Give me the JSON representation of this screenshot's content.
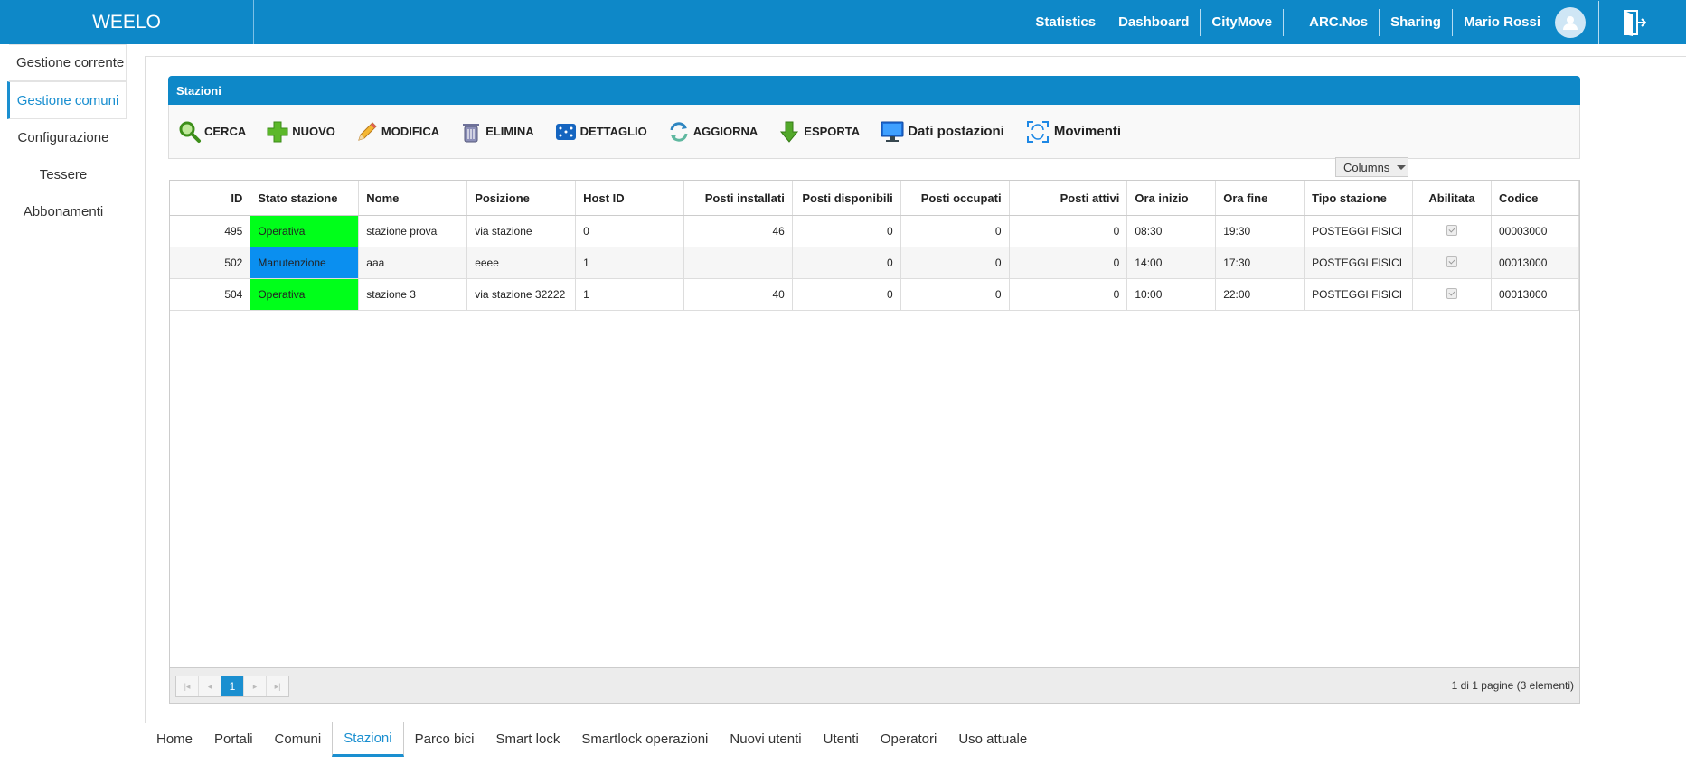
{
  "app": {
    "brand": "WEELO"
  },
  "topnav": {
    "items": [
      "Statistics",
      "Dashboard",
      "CityMove",
      "ARC.Nos",
      "Sharing"
    ],
    "user": "Mario Rossi"
  },
  "sidebar": {
    "items": [
      "Gestione corrente",
      "Gestione comuni",
      "Configurazione",
      "Tessere",
      "Abbonamenti"
    ]
  },
  "panel": {
    "title": "Stazioni"
  },
  "toolbar": {
    "cerca": "CERCA",
    "nuovo": "NUOVO",
    "modifica": "MODIFICA",
    "elimina": "ELIMINA",
    "dettaglio": "DETTAGLIO",
    "aggiorna": "AGGIORNA",
    "esporta": "ESPORTA",
    "dati_postazioni": "Dati postazioni",
    "movimenti": "Movimenti"
  },
  "columns_button": "Columns",
  "table": {
    "headers": [
      "ID",
      "Stato stazione",
      "Nome",
      "Posizione",
      "Host ID",
      "Posti installati",
      "Posti disponibili",
      "Posti occupati",
      "Posti attivi",
      "Ora inizio",
      "Ora fine",
      "Tipo stazione",
      "Abilitata",
      "Codice"
    ],
    "rows": [
      [
        "495",
        "Operativa",
        "stazione prova",
        "via stazione",
        "0",
        "46",
        "0",
        "0",
        "0",
        "08:30",
        "19:30",
        "POSTEGGI FISICI",
        "",
        "00003000"
      ],
      [
        "502",
        "Manutenzione",
        "aaa",
        "eeee",
        "1",
        "",
        "0",
        "0",
        "0",
        "14:00",
        "17:30",
        "POSTEGGI FISICI",
        "",
        "00013000"
      ],
      [
        "504",
        "Operativa",
        "stazione 3",
        "via stazione 32222",
        "1",
        "40",
        "0",
        "0",
        "0",
        "10:00",
        "22:00",
        "POSTEGGI FISICI",
        "",
        "00013000"
      ]
    ],
    "status_colors": {
      "Operativa": "#00ff1a",
      "Manutenzione": "#0a8ff0"
    }
  },
  "pager": {
    "current_page": "1",
    "info": "1 di 1 pagine (3 elementi)"
  },
  "tabs": [
    "Home",
    "Portali",
    "Comuni",
    "Stazioni",
    "Parco bici",
    "Smart lock",
    "Smartlock operazioni",
    "Nuovi utenti",
    "Utenti",
    "Operatori",
    "Uso attuale"
  ],
  "colors": {
    "accent": "#0e88c8",
    "active": "#1a8fd0"
  }
}
